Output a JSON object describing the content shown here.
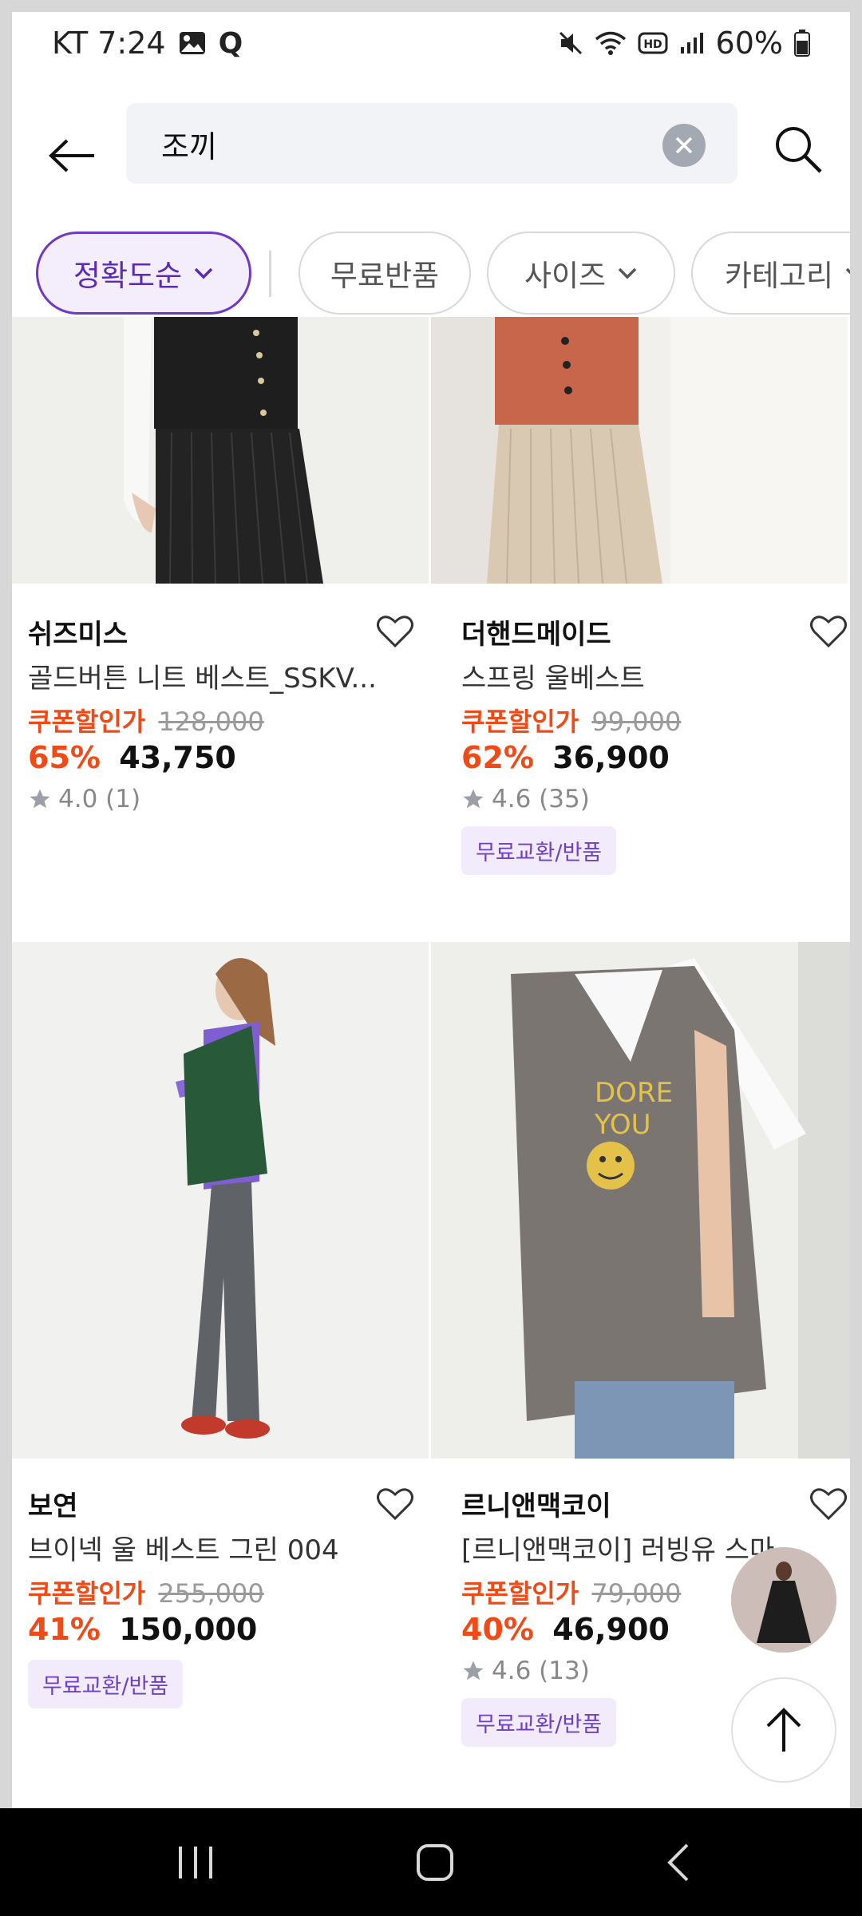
{
  "status_bar": {
    "carrier_time": "KT 7:24",
    "battery": "60%",
    "icons": [
      "gallery-icon",
      "q-icon",
      "mute-icon",
      "wifi-icon",
      "hd-icon",
      "signal-icon",
      "battery-icon"
    ]
  },
  "search": {
    "query": "조끼"
  },
  "filters": {
    "chips": [
      {
        "label": "정확도순",
        "active": true,
        "dropdown": true
      },
      {
        "label": "무료반품",
        "active": false,
        "dropdown": false
      },
      {
        "label": "사이즈",
        "active": false,
        "dropdown": true
      },
      {
        "label": "카테고리",
        "active": false,
        "dropdown": true
      }
    ]
  },
  "products": [
    {
      "brand": "쉬즈미스",
      "name": "골드버튼 니트 베스트_SSKV...",
      "coupon_label": "쿠폰할인가",
      "original_price": "128,000",
      "discount": "65%",
      "price": "43,750",
      "rating": "4.0 (1)",
      "badge": ""
    },
    {
      "brand": "더핸드메이드",
      "name": "스프링 울베스트",
      "coupon_label": "쿠폰할인가",
      "original_price": "99,000",
      "discount": "62%",
      "price": "36,900",
      "rating": "4.6 (35)",
      "badge": "무료교환/반품"
    },
    {
      "brand": "보연",
      "name": "브이넥 울 베스트 그린 004",
      "coupon_label": "쿠폰할인가",
      "original_price": "255,000",
      "discount": "41%",
      "price": "150,000",
      "rating": "",
      "badge": "무료교환/반품"
    },
    {
      "brand": "르니앤맥코이",
      "name": "[르니앤맥코이] 러빙유 스마일...",
      "coupon_label": "쿠폰할인가",
      "original_price": "79,000",
      "discount": "40%",
      "price": "46,900",
      "rating": "4.6 (13)",
      "badge": "무료교환/반품"
    }
  ],
  "colors": {
    "accent": "#6f38c5",
    "discount": "#ee4b19",
    "badge_bg": "#f1ebfb",
    "badge_text": "#6f40c4"
  }
}
